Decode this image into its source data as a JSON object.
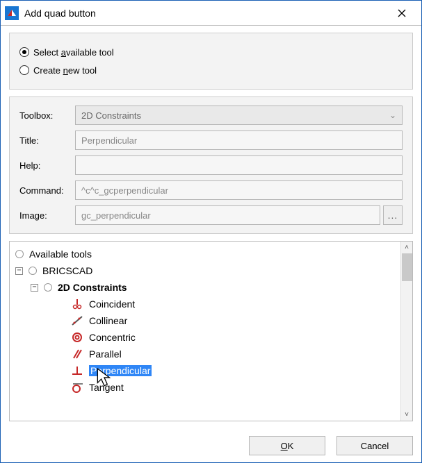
{
  "window": {
    "title": "Add quad button"
  },
  "options": {
    "select_available": "Select available tool",
    "create_new": "Create new tool"
  },
  "form": {
    "toolbox_label": "Toolbox:",
    "toolbox_value": "2D Constraints",
    "title_label": "Title:",
    "title_value": "Perpendicular",
    "help_label": "Help:",
    "help_value": "",
    "command_label": "Command:",
    "command_value": "^c^c_gcperpendicular",
    "image_label": "Image:",
    "image_value": "gc_perpendicular"
  },
  "tree": {
    "root": "Available tools",
    "bricscad": "BRICSCAD",
    "category": "2D Constraints",
    "items": [
      "Coincident",
      "Collinear",
      "Concentric",
      "Parallel",
      "Perpendicular",
      "Tangent"
    ],
    "selected_index": 4
  },
  "buttons": {
    "ok": "OK",
    "cancel": "Cancel",
    "browse": "..."
  },
  "icons": {
    "app": "bricscad-logo-icon",
    "close": "close-icon",
    "chevron": "chevron-down-icon",
    "expand_minus": "−",
    "scroll_up": "˄",
    "scroll_down": "˅"
  }
}
